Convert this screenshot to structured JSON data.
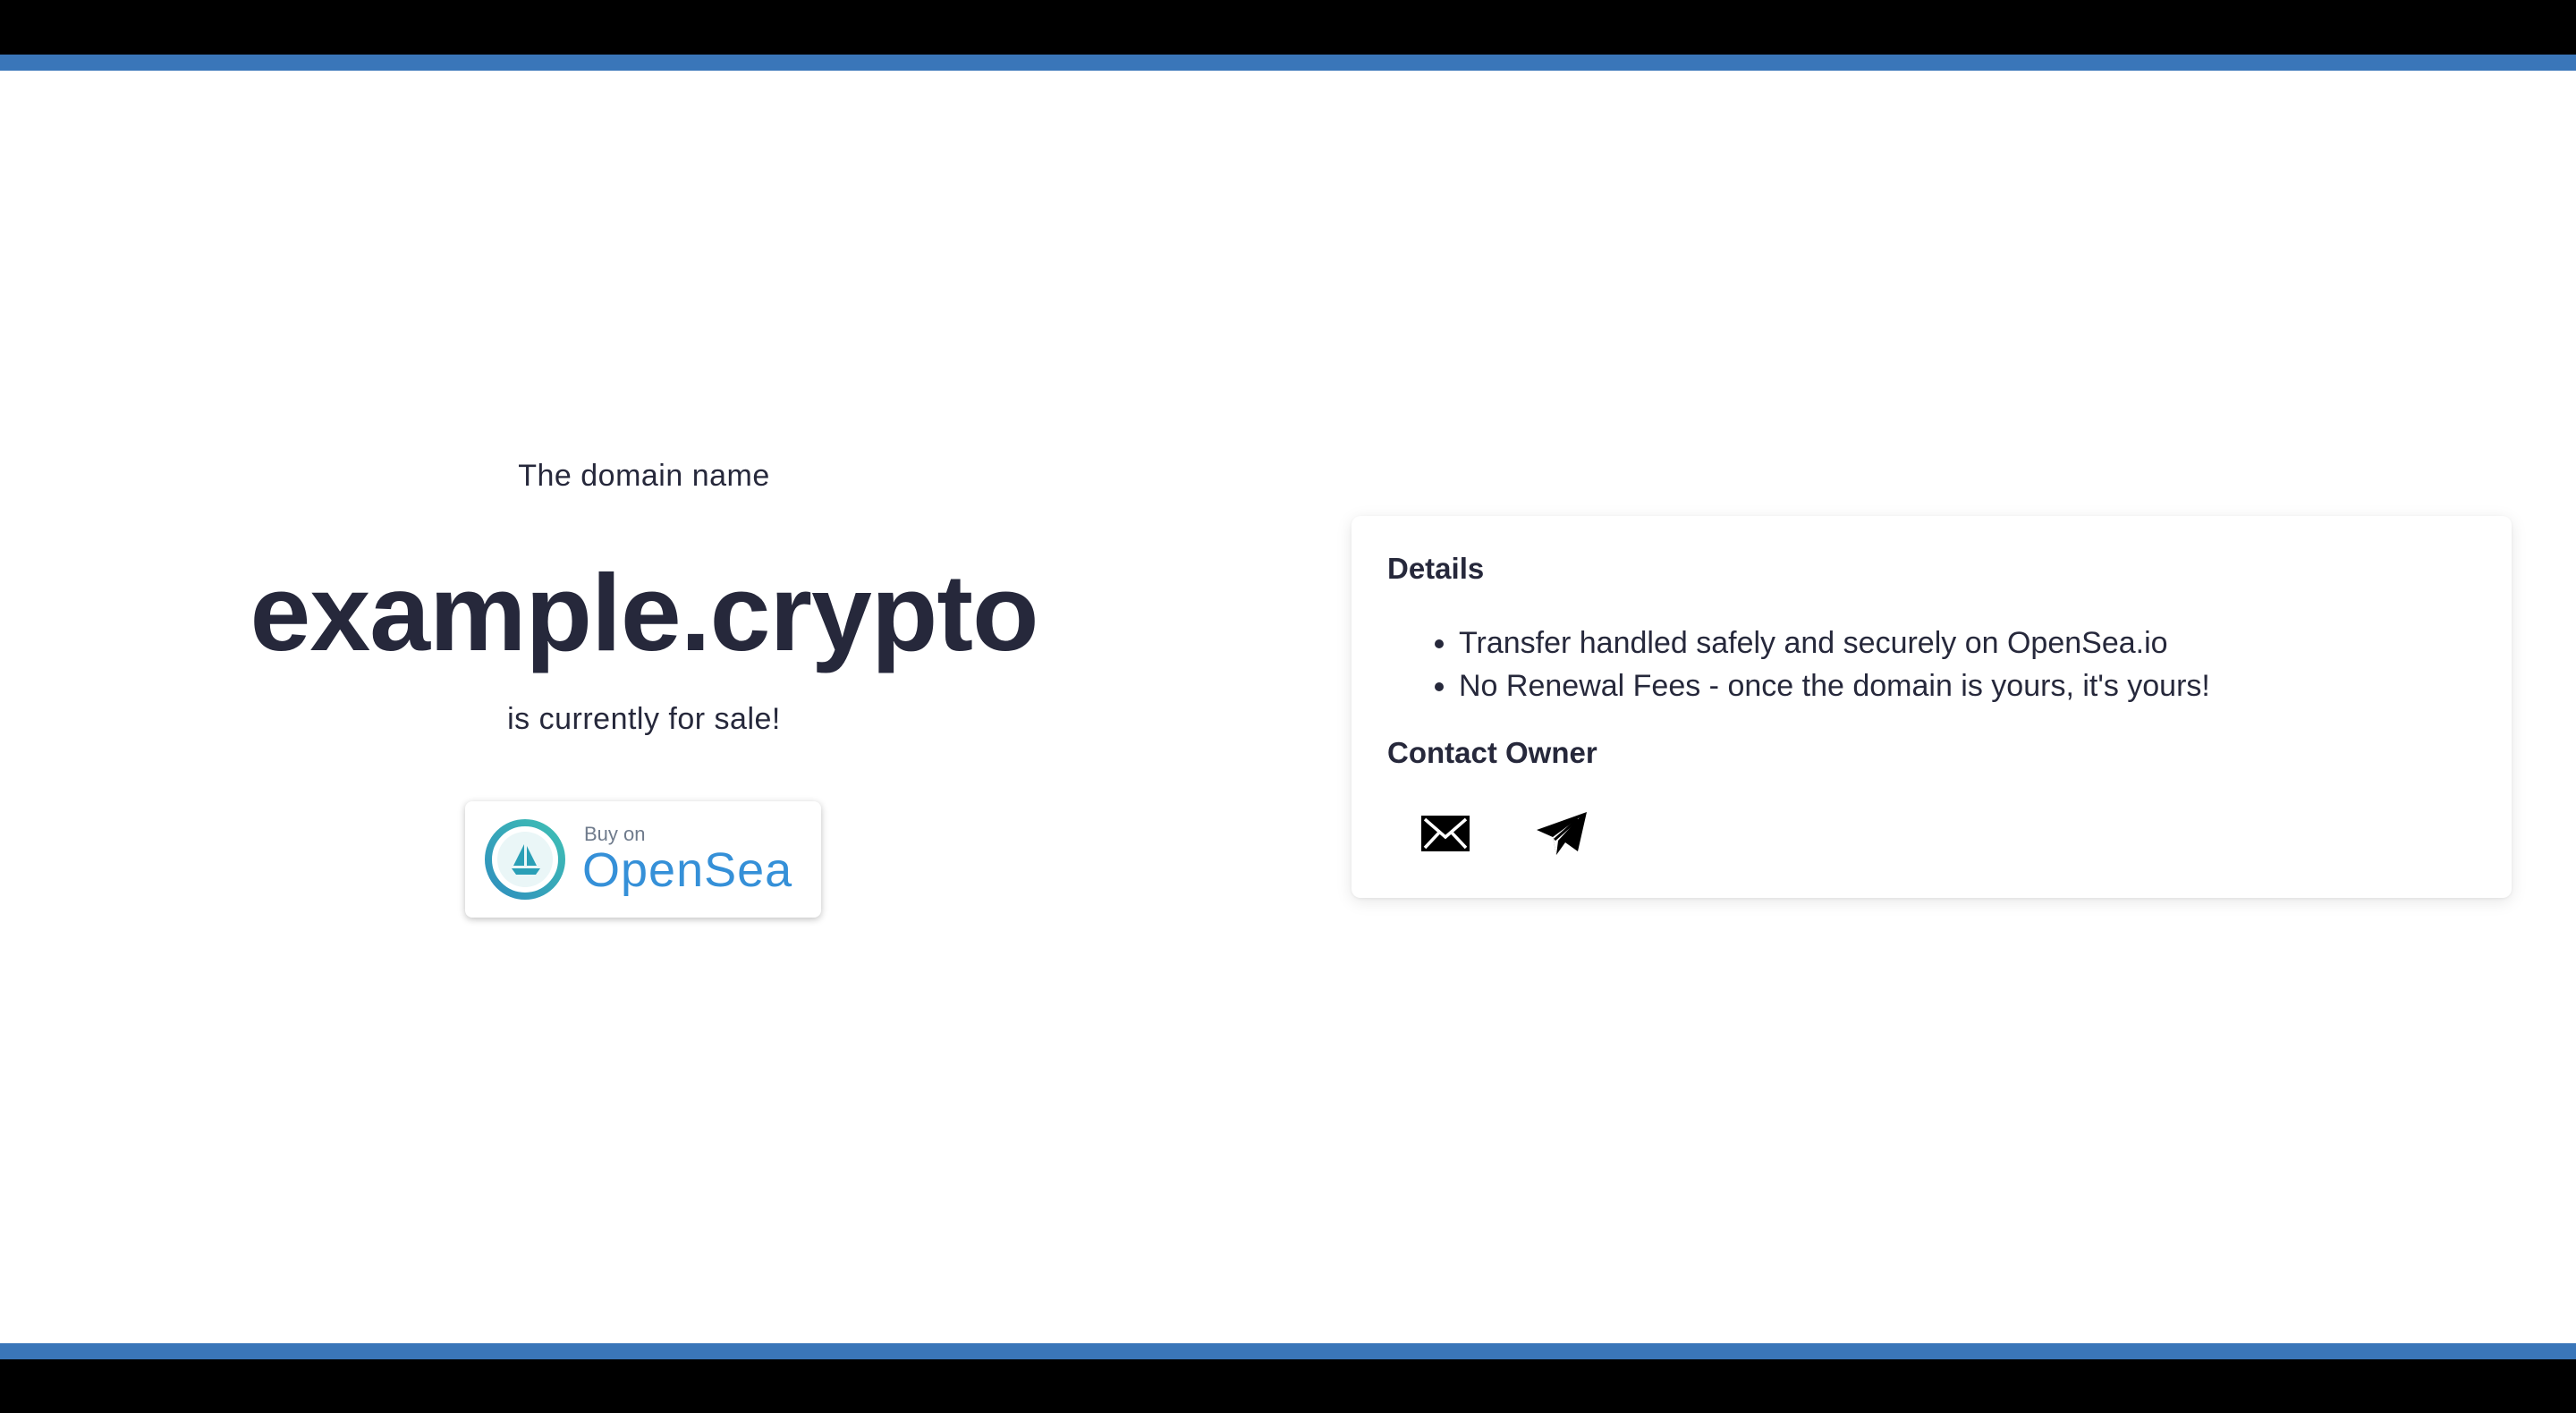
{
  "hero": {
    "intro": "The domain name",
    "domain": "example.crypto",
    "status": "is currently for sale!"
  },
  "opensea_button": {
    "buy_label": "Buy on",
    "brand_label": "OpenSea",
    "icon": "opensea-ship-icon",
    "brand_color": "#3590d8"
  },
  "details": {
    "title": "Details",
    "items": [
      "Transfer handled safely and securely on OpenSea.io",
      "No Renewal Fees - once the domain is yours, it's yours!"
    ]
  },
  "contact": {
    "title": "Contact Owner",
    "icons": [
      "mail-icon",
      "telegram-icon"
    ]
  },
  "colors": {
    "accent_stripe": "#3a76b9",
    "text": "#26283b",
    "frame": "#000000"
  }
}
